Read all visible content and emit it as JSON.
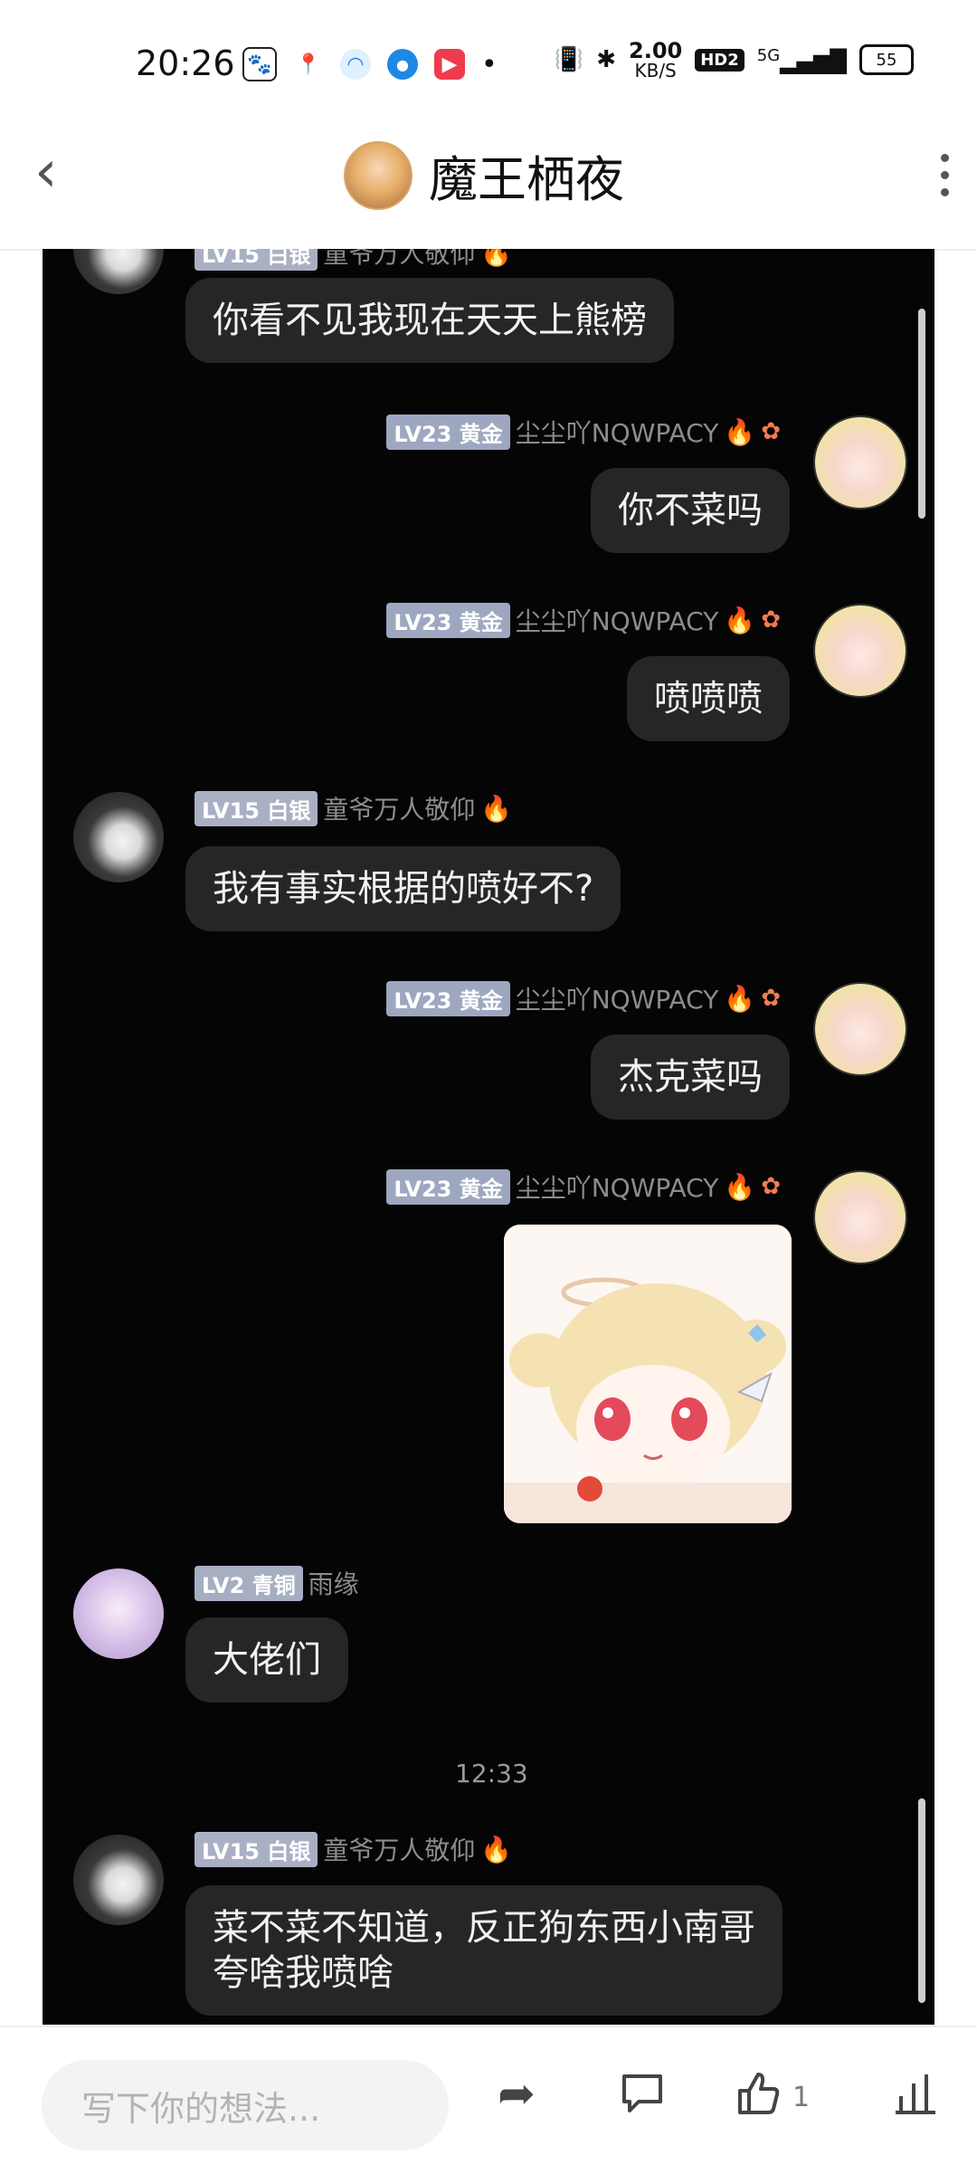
{
  "status_bar": {
    "time": "20:26",
    "net_speed_value": "2.00",
    "net_speed_unit": "KB/S",
    "hd_label": "HD2",
    "network_label": "5G",
    "battery": "55",
    "app_icons": [
      "baidu-icon",
      "maps-icon",
      "browser-icon",
      "location-icon",
      "video-icon"
    ]
  },
  "header": {
    "title": "魔王栖夜"
  },
  "chat": {
    "messages": [
      {
        "side": "left",
        "level": "LV15",
        "rank": "白银",
        "name": "童爷万人敬仰",
        "text": "你看不见我现在天天上熊榜"
      },
      {
        "side": "right",
        "level": "LV23",
        "rank": "黄金",
        "name": "尘尘吖NQWPACY",
        "text": "你不菜吗"
      },
      {
        "side": "right",
        "level": "LV23",
        "rank": "黄金",
        "name": "尘尘吖NQWPACY",
        "text": "喷喷喷"
      },
      {
        "side": "left",
        "level": "LV15",
        "rank": "白银",
        "name": "童爷万人敬仰",
        "text": "我有事实根据的喷好不?"
      },
      {
        "side": "right",
        "level": "LV23",
        "rank": "黄金",
        "name": "尘尘吖NQWPACY",
        "text": "杰克菜吗"
      },
      {
        "side": "right",
        "level": "LV23",
        "rank": "黄金",
        "name": "尘尘吖NQWPACY",
        "text": ""
      },
      {
        "side": "left",
        "level": "LV2",
        "rank": "青铜",
        "name": "雨缘",
        "text": "大佬们"
      },
      {
        "side": "left",
        "level": "LV15",
        "rank": "白银",
        "name": "童爷万人敬仰",
        "text": "菜不菜不知道，反正狗东西小南哥夸啥我喷啥"
      }
    ],
    "timestamp": "12:33"
  },
  "bottom_bar": {
    "input_placeholder": "写下你的想法...",
    "like_count": "1"
  }
}
